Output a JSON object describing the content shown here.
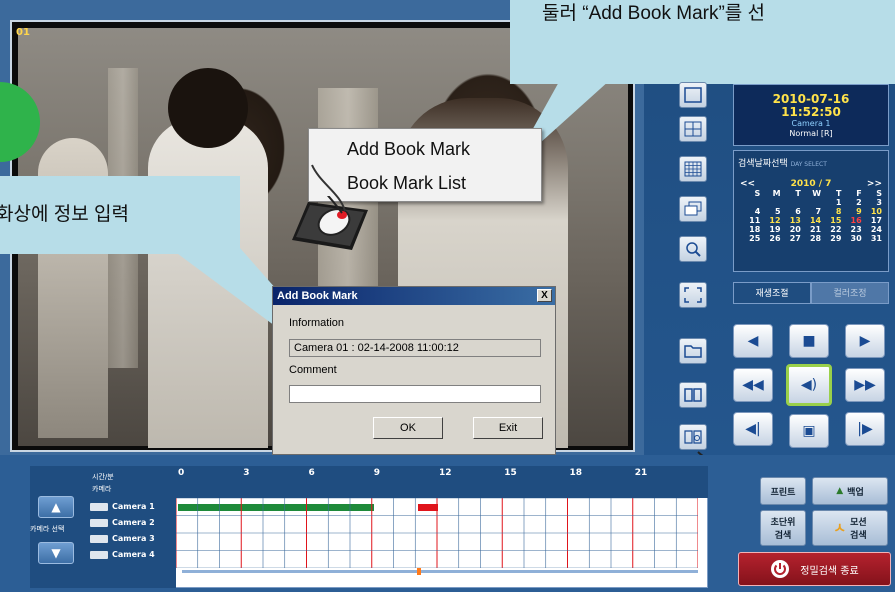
{
  "video": {
    "channel": "01"
  },
  "callouts": {
    "top_text": "둘러  “Add Book Mark”를 선",
    "left_text": "화상에 정보 입력"
  },
  "context_menu": {
    "items": [
      "Add Book Mark",
      "Book Mark List"
    ]
  },
  "dialog": {
    "title": "Add Book Mark",
    "info_label": "Information",
    "info_value": "Camera 01  : 02-14-2008 11:00:12",
    "comment_label": "Comment",
    "comment_value": "",
    "ok": "OK",
    "exit": "Exit",
    "close": "X"
  },
  "status": {
    "date": "2010-07-16",
    "time": "11:52:50",
    "camera": "Camera 1",
    "mode": "Normal [R]"
  },
  "calendar": {
    "title": "검색날짜선택",
    "subtitle": "DAY SELECT",
    "header": "2010 / 7",
    "prev": "<<",
    "next": ">>",
    "weekdays": [
      "S",
      "M",
      "T",
      "W",
      "T",
      "F",
      "S"
    ],
    "weeks": [
      [
        "",
        "",
        "",
        "",
        "1",
        "2",
        "3"
      ],
      [
        "4",
        "5",
        "6",
        "7",
        "8",
        "9",
        "10"
      ],
      [
        "11",
        "12",
        "13",
        "14",
        "15",
        "16",
        "17"
      ],
      [
        "18",
        "19",
        "20",
        "21",
        "22",
        "23",
        "24"
      ],
      [
        "25",
        "26",
        "27",
        "28",
        "29",
        "30",
        "31"
      ]
    ],
    "highlight_yellow": [
      "8",
      "9",
      "10",
      "12",
      "13",
      "14",
      "15"
    ],
    "highlight_red": [
      "16"
    ]
  },
  "tabs": [
    "재생조절",
    "컬러조정"
  ],
  "timeline": {
    "corner_top": "시간/분",
    "corner_bottom": "카메라",
    "hours": [
      "0",
      "3",
      "6",
      "9",
      "12",
      "15",
      "18",
      "21"
    ],
    "cameras": [
      "Camera 1",
      "Camera 2",
      "Camera 3",
      "Camera 4"
    ],
    "camera_select_label": "카메라 선택"
  },
  "buttons": {
    "print": "프린트",
    "backup": "백업",
    "sec_search": "초단위\n검색",
    "motion_search": "모션\n검색",
    "end_search": "정밀검색 종료"
  },
  "colors": {
    "accent": "#1f4d80",
    "record_green": "#1e8a3a",
    "record_red": "#e0141b",
    "callout": "#b7dde8"
  }
}
